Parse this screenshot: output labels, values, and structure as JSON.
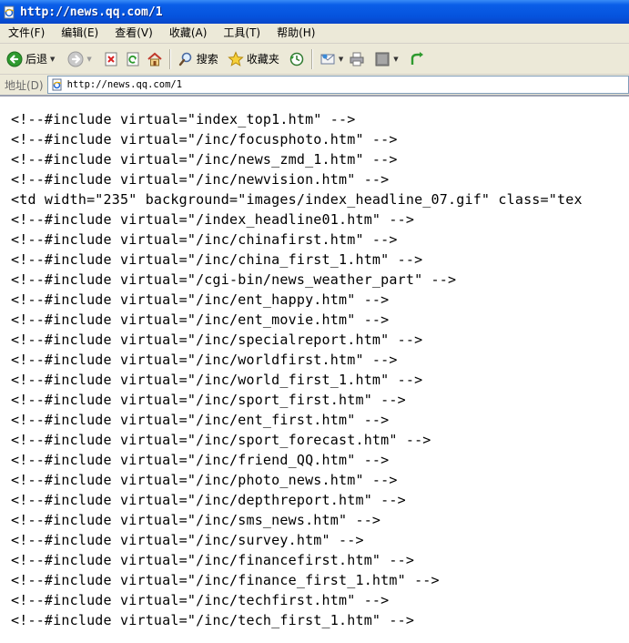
{
  "window": {
    "title": "http://news.qq.com/1"
  },
  "menu": [
    "文件(F)",
    "编辑(E)",
    "查看(V)",
    "收藏(A)",
    "工具(T)",
    "帮助(H)"
  ],
  "toolbar": {
    "back_label": "后退",
    "search_label": "搜索",
    "favorites_label": "收藏夹"
  },
  "address": {
    "label": "地址(D)",
    "url": "http://news.qq.com/1"
  },
  "code_lines": [
    "<!--#include virtual=\"index_top1.htm\" -->",
    "<!--#include virtual=\"/inc/focusphoto.htm\" -->",
    "<!--#include virtual=\"/inc/news_zmd_1.htm\" -->",
    "<!--#include virtual=\"/inc/newvision.htm\" -->",
    "<td width=\"235\" background=\"images/index_headline_07.gif\" class=\"tex",
    "<!--#include virtual=\"/index_headline01.htm\" -->",
    "<!--#include virtual=\"/inc/chinafirst.htm\" -->",
    "<!--#include virtual=\"/inc/china_first_1.htm\" -->",
    "<!--#include virtual=\"/cgi-bin/news_weather_part\" -->",
    "<!--#include virtual=\"/inc/ent_happy.htm\" -->",
    "<!--#include virtual=\"/inc/ent_movie.htm\" -->",
    "<!--#include virtual=\"/inc/specialreport.htm\" -->",
    "<!--#include virtual=\"/inc/worldfirst.htm\" -->",
    "<!--#include virtual=\"/inc/world_first_1.htm\" -->",
    "<!--#include virtual=\"/inc/sport_first.htm\" -->",
    "<!--#include virtual=\"/inc/ent_first.htm\" -->",
    "<!--#include virtual=\"/inc/sport_forecast.htm\" -->",
    "<!--#include virtual=\"/inc/friend_QQ.htm\" -->",
    "<!--#include virtual=\"/inc/photo_news.htm\" -->",
    "<!--#include virtual=\"/inc/depthreport.htm\" -->",
    "<!--#include virtual=\"/inc/sms_news.htm\" -->",
    "<!--#include virtual=\"/inc/survey.htm\" -->",
    "<!--#include virtual=\"/inc/financefirst.htm\" -->",
    "<!--#include virtual=\"/inc/finance_first_1.htm\" -->",
    "<!--#include virtual=\"/inc/techfirst.htm\" -->",
    "<!--#include virtual=\"/inc/tech_first_1.htm\" -->"
  ],
  "icons": {
    "page": "ie-page-icon",
    "back": "back-arrow-icon",
    "forward": "forward-arrow-icon",
    "stop": "stop-icon",
    "refresh": "refresh-icon",
    "home": "home-icon",
    "search": "search-icon",
    "favorites": "star-icon",
    "history": "history-icon",
    "mail": "mail-icon",
    "print": "print-icon",
    "edit": "edit-icon",
    "messenger": "messenger-icon"
  },
  "colors": {
    "titlebar": "#0553dd",
    "chrome": "#ece9d8"
  }
}
